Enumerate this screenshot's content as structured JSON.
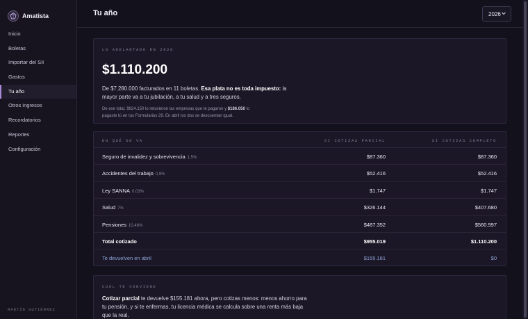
{
  "app": {
    "name": "Amatista",
    "user": "MARTÍN GUTIÉRREZ"
  },
  "nav": [
    {
      "label": "Inicio",
      "active": false
    },
    {
      "label": "Boletas",
      "active": false
    },
    {
      "label": "Importar del SII",
      "active": false
    },
    {
      "label": "Gastos",
      "active": false
    },
    {
      "label": "Tu año",
      "active": true
    },
    {
      "label": "Otros ingresos",
      "active": false
    },
    {
      "label": "Recordatorios",
      "active": false
    },
    {
      "label": "Reportes",
      "active": false
    },
    {
      "label": "Configuración",
      "active": false
    }
  ],
  "header": {
    "title": "Tu año",
    "year": "2026"
  },
  "hero": {
    "eyebrow": "LO ADELANTADO EN 2026",
    "amount": "$1.110.200",
    "desc_pre": "De $7.280.000 facturados en 11 boletas. ",
    "desc_bold": "Esa plata no es toda impuesto:",
    "desc_post": " la mayor parte va a tu jubilación, a tu salud y a tres seguros.",
    "note_1": "De ese total, $924.150 lo retuvieron las empresas que te pagaron y ",
    "note_bold": "$186.050",
    "note_2": " lo pagaste tú en tus Formularios 29. En abril los dos se descuentan igual."
  },
  "table": {
    "headers": {
      "label": "EN QUÉ SE VA",
      "partial": "SI COTIZAS PARCIAL",
      "full": "SI COTIZAS COMPLETO"
    },
    "rows": [
      {
        "label": "Seguro de invalidez y sobrevivencia",
        "pct": "1,5%",
        "partial": "$87.360",
        "full": "$87.360"
      },
      {
        "label": "Accidentes del trabajo",
        "pct": "0,9%",
        "partial": "$52.416",
        "full": "$52.416"
      },
      {
        "label": "Ley SANNA",
        "pct": "0,03%",
        "partial": "$1.747",
        "full": "$1.747"
      },
      {
        "label": "Salud",
        "pct": "7%",
        "partial": "$326.144",
        "full": "$407.680"
      },
      {
        "label": "Pensiones",
        "pct": "10,46%",
        "partial": "$487.352",
        "full": "$560.997"
      }
    ],
    "total": {
      "label": "Total cotizado",
      "partial": "$955.019",
      "full": "$1.110.200"
    },
    "refund": {
      "label": "Te devuelven en abril",
      "partial": "$155.181",
      "full": "$0"
    }
  },
  "advice": {
    "eyebrow": "CUÁL TE CONVIENE",
    "bold": "Cotizar parcial",
    "text": " te devuelve $155.181 ahora, pero cotizas menos: menos ahorro para tu pensión, y si te enfermas, tu licencia médica se calcula sobre una renta más baja que la real."
  },
  "colors": {
    "accent": "#a98ad8",
    "refund": "#8fa3d6",
    "background": "#13111c"
  }
}
